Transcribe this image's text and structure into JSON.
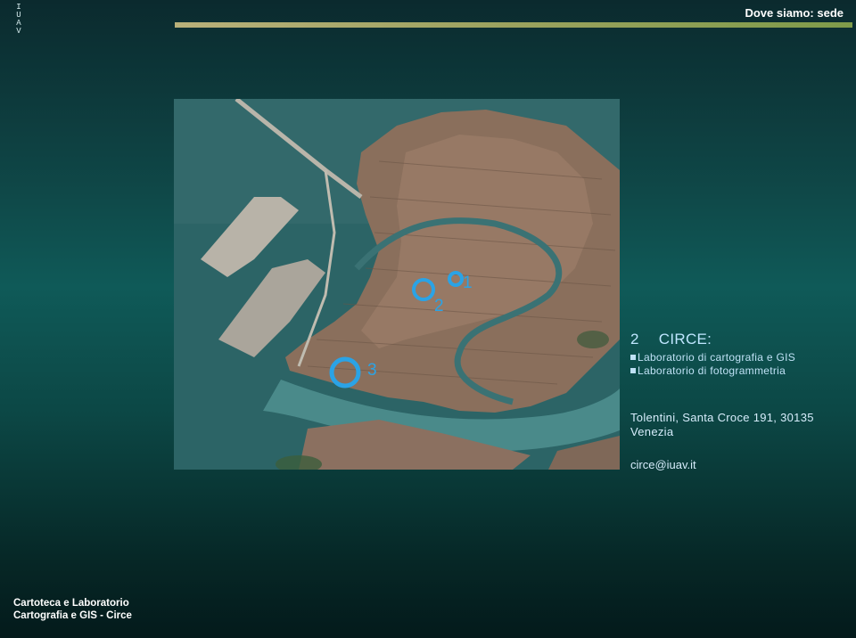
{
  "header": {
    "logo_letters": [
      "I",
      "U",
      "A",
      "V"
    ],
    "title": "Dove siamo: sede"
  },
  "map": {
    "markers": [
      "1",
      "2",
      "3"
    ]
  },
  "info": {
    "number": "2",
    "name": "CIRCE:",
    "items": [
      "Laboratorio di cartografia e GIS",
      "Laboratorio di fotogrammetria"
    ],
    "address_line1": "Tolentini, Santa Croce 191, 30135",
    "address_line2": "Venezia",
    "email": "circe@iuav.it"
  },
  "footer": {
    "line1": "Cartoteca e Laboratorio",
    "line2": "Cartografia e GIS - Circe"
  },
  "colors": {
    "background_top": "#0b2a2e",
    "background_mid": "#0f5a58",
    "accent_text": "#8fd2f5",
    "marker": "#2aa3e6"
  }
}
